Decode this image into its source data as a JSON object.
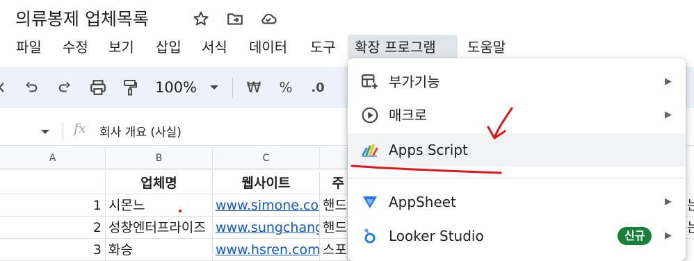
{
  "app": {
    "title": "의류봉제 업체목록"
  },
  "menubar": {
    "items": [
      "파일",
      "수정",
      "보기",
      "삽입",
      "서식",
      "데이터",
      "도구",
      "확장 프로그램",
      "도움말"
    ],
    "active": "확장 프로그램"
  },
  "toolbar": {
    "zoom": "100%",
    "currency": "₩",
    "percent": "%",
    "decimal_decrease": ".0"
  },
  "formula_bar": {
    "fx": "fx",
    "content": "회사 개요 (사실)"
  },
  "grid": {
    "columns": [
      "A",
      "B",
      "C"
    ],
    "header_row": {
      "b": "업체명",
      "c": "웹사이트",
      "d": "주"
    },
    "rows": [
      {
        "a": "1",
        "b": "시몬느",
        "c": "www.simone.co.",
        "d": "핸드"
      },
      {
        "a": "2",
        "b": "성창엔터프라이즈",
        "c": "www.sungchang",
        "d": "핸드"
      },
      {
        "a": "3",
        "b": "화승",
        "c": "www.hsren.com",
        "d": "스포"
      }
    ],
    "right_edge": [
      "는",
      "는"
    ]
  },
  "extensions_menu": {
    "items": [
      {
        "label": "부가기능",
        "icon": "add-ons-icon",
        "has_submenu": true
      },
      {
        "label": "매크로",
        "icon": "macro-play-icon",
        "has_submenu": true
      },
      {
        "label": "Apps Script",
        "icon": "apps-script-icon",
        "has_submenu": false
      },
      {
        "label": "AppSheet",
        "icon": "appsheet-icon",
        "has_submenu": true
      },
      {
        "label": "Looker Studio",
        "icon": "looker-studio-icon",
        "has_submenu": true,
        "badge": "신규"
      }
    ],
    "submenu_arrow": "▶"
  },
  "colors": {
    "annotation": "#e0121a",
    "toolbar_bg": "#edf2fa",
    "link": "#1155cc",
    "badge": "#188038"
  }
}
